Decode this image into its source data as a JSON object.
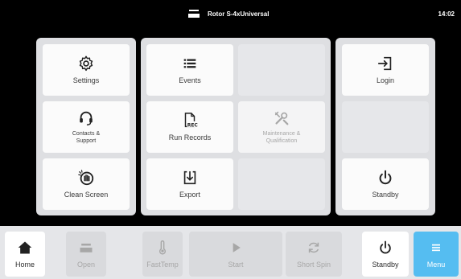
{
  "statusbar": {
    "rotor_text": "Rotor S-4xUniversal",
    "time": "14:02"
  },
  "tiles": {
    "settings": "Settings",
    "events": "Events",
    "login": "Login",
    "contacts_line1": "Contacts &",
    "contacts_line2": "Support",
    "run_records": "Run Records",
    "maintenance_line1": "Maintenance &",
    "maintenance_line2": "Qualification",
    "clean_screen": "Clean Screen",
    "export": "Export",
    "standby": "Standby"
  },
  "bottom": {
    "home": "Home",
    "open": "Open",
    "fasttemp": "FastTemp",
    "start": "Start",
    "short_spin": "Short Spin",
    "standby": "Standby",
    "menu": "Menu"
  },
  "colors": {
    "accent": "#55bdf1",
    "panel": "#dedfe2",
    "tile": "#fbfbfb"
  }
}
